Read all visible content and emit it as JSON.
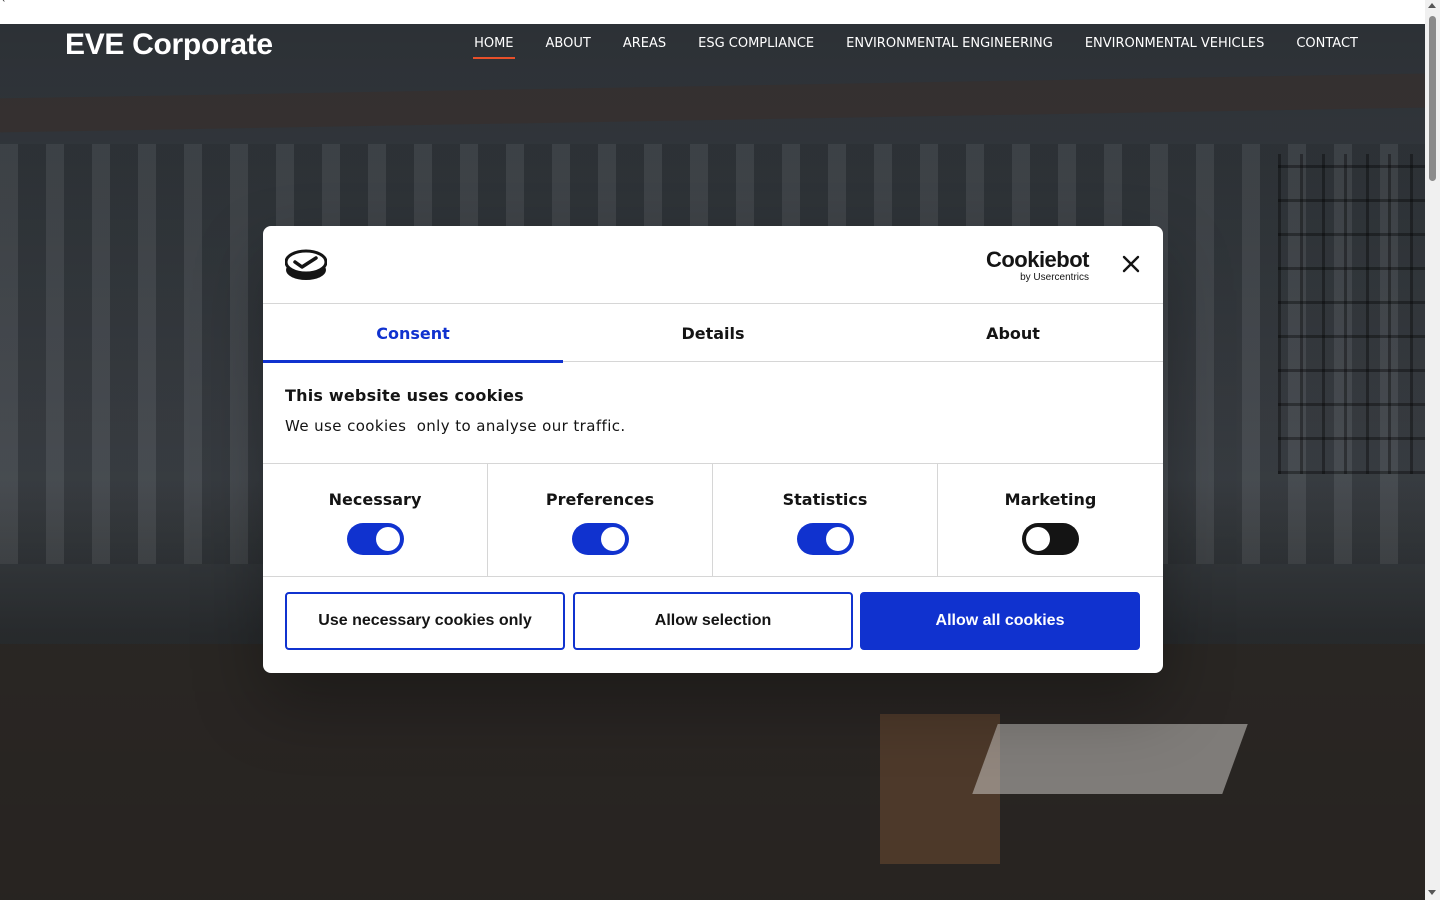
{
  "top_strip": {
    "mark": "`"
  },
  "site": {
    "brand": "EVE Corporate",
    "nav": [
      {
        "label": "HOME",
        "active": true
      },
      {
        "label": "ABOUT",
        "active": false
      },
      {
        "label": "AREAS",
        "active": false
      },
      {
        "label": "ESG COMPLIANCE",
        "active": false
      },
      {
        "label": "ENVIRONMENTAL ENGINEERING",
        "active": false
      },
      {
        "label": "ENVIRONMENTAL VEHICLES",
        "active": false
      },
      {
        "label": "CONTACT",
        "active": false
      }
    ],
    "accent_color": "#e8502a"
  },
  "cookie_dialog": {
    "brand_name": "Cookiebot",
    "brand_sub": "by Usercentrics",
    "close_icon": "close-icon",
    "tabs": [
      {
        "label": "Consent",
        "active": true
      },
      {
        "label": "Details",
        "active": false
      },
      {
        "label": "About",
        "active": false
      }
    ],
    "heading": "This website uses cookies",
    "description": "We use cookies  only to analyse our traffic.",
    "toggles": [
      {
        "label": "Necessary",
        "checked": true
      },
      {
        "label": "Preferences",
        "checked": true
      },
      {
        "label": "Statistics",
        "checked": true
      },
      {
        "label": "Marketing",
        "checked": false
      }
    ],
    "buttons": {
      "necessary_only": "Use necessary cookies only",
      "allow_selection": "Allow selection",
      "allow_all": "Allow all cookies"
    },
    "primary_color": "#1032cf"
  }
}
